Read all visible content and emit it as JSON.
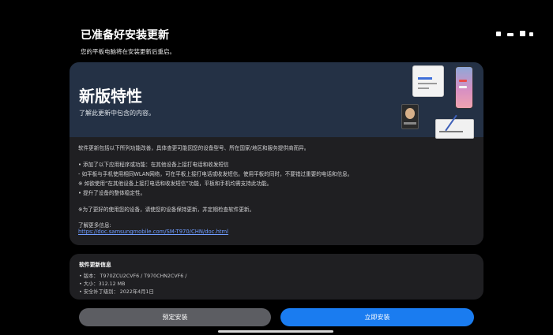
{
  "header": {
    "title": "已准备好安装更新",
    "subtitle": "您的平板电脑将在安装更新后重启。"
  },
  "hero": {
    "title": "新版特性",
    "subtitle": "了解此更新中包含的内容。"
  },
  "notes": {
    "intro": "软件更新包括以下所列功能改善，具体查更可能因您的设备型号、所在国家/地区和服务提供商而异。",
    "feature_header": "• 添加了以下应用程序或功能：在其他设备上接打电话和收发短信",
    "feature_detail": "- 如平板与手机使用相同WLAN网络，可在平板上接打电话或收发短信。使用平板的同时，不要错过重要的电话和信息。",
    "feature_note": "※ 如欲使用“在其他设备上接打电话和收发短信”功能，平板和手机均需支持此功能。",
    "stability": "• 提升了设备的整体稳定性。",
    "reminder": "※为了更好的使用您的设备，请使您的设备保持更新，并定期检查软件更新。",
    "learn_more_label": "了解更多信息:",
    "learn_more_url": "https://doc.samsungmobile.com/SM-T970/CHN/doc.html"
  },
  "info": {
    "title": "软件更新信息",
    "version": "• 版本： T970ZCU2CVF6 / T970CHN2CVF6 /",
    "size": "• 大小：312.12 MB",
    "security_patch": "• 安全补丁级别： 2022年4月1日"
  },
  "buttons": {
    "schedule": "预定安装",
    "install": "立即安装"
  },
  "colors": {
    "background": "#000000",
    "card": "#1f1f22",
    "hero": "#243145",
    "accent": "#1a7cf0",
    "link": "#6f9cff",
    "secondary_button": "#5c5d62"
  },
  "icons": [
    "tablet-illustration",
    "phone-illustration",
    "video-call-illustration",
    "tablet-pen-illustration",
    "status-icons"
  ]
}
